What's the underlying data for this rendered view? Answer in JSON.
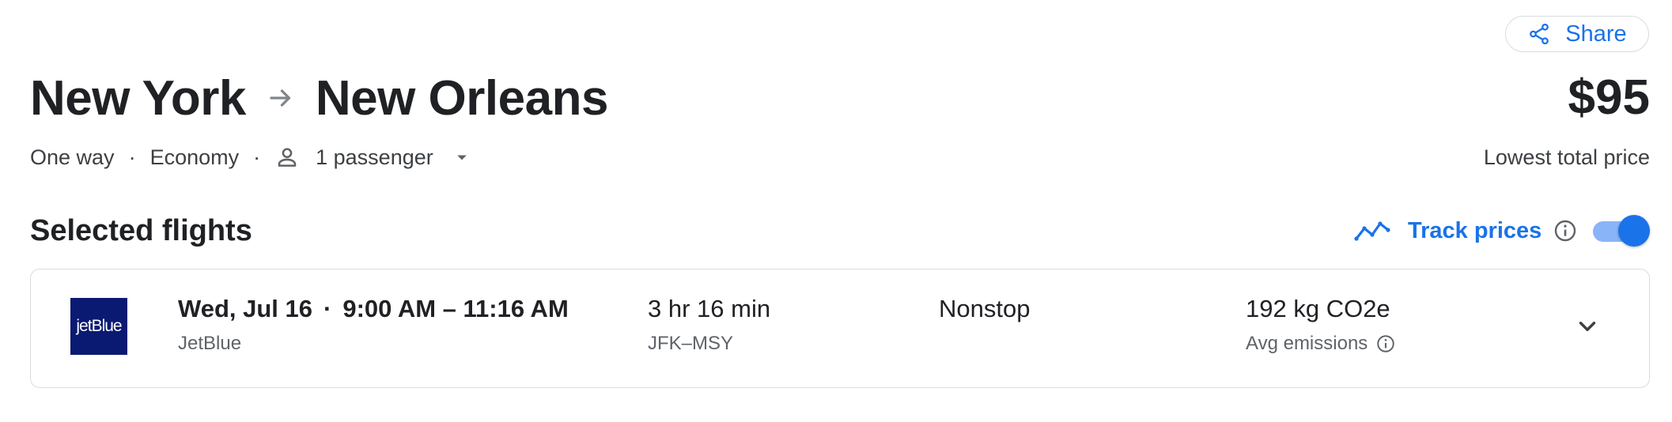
{
  "header": {
    "share_label": "Share",
    "origin": "New York",
    "destination": "New Orleans",
    "price": "$95",
    "price_caption": "Lowest total price"
  },
  "trip_options": {
    "trip_type": "One way",
    "cabin_class": "Economy",
    "passengers": "1 passenger"
  },
  "selected": {
    "title": "Selected flights",
    "track_label": "Track prices",
    "track_enabled": true
  },
  "flight": {
    "airline_logo_text": "jetBlue",
    "date": "Wed, Jul 16",
    "time_range": "9:00 AM – 11:16 AM",
    "airline": "JetBlue",
    "duration": "3 hr 16 min",
    "route": "JFK–MSY",
    "stops": "Nonstop",
    "emissions": "192 kg CO2e",
    "emissions_label": "Avg emissions"
  },
  "colors": {
    "accent": "#1a73e8",
    "toggle_track": "#8ab4f8",
    "jetblue_logo_bg": "#0a1a72"
  }
}
